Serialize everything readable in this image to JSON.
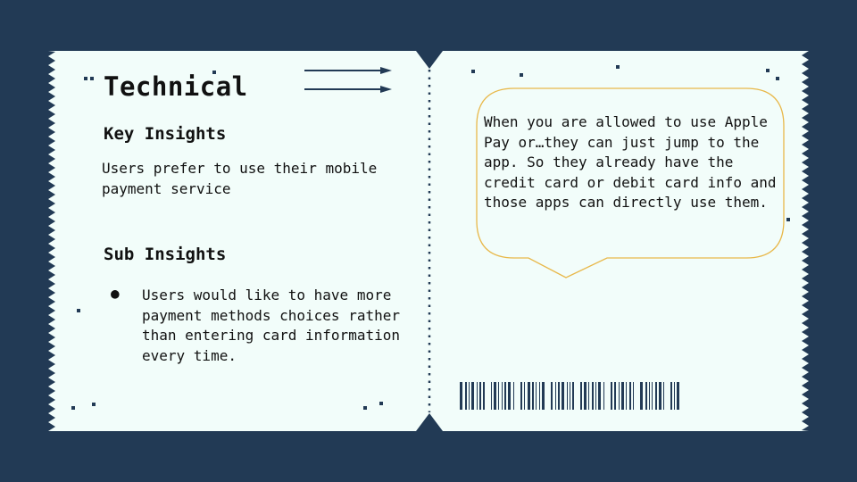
{
  "ticket": {
    "title": "Technical",
    "key_insights": {
      "heading": "Key Insights",
      "text": "Users prefer to use their mobile payment service"
    },
    "sub_insights": {
      "heading": "Sub Insights",
      "bullet": "●",
      "items": [
        "Users would like to have more payment methods choices rather than entering card information every time."
      ]
    },
    "quote": "When you are allowed to use Apple Pay or…they can just jump to the app. So they already have the credit card or debit card info and those apps can directly use them."
  },
  "colors": {
    "background": "#223a55",
    "ticket": "#f2fdfa",
    "accent_dark": "#223a55",
    "bubble_border": "#e8b84a"
  },
  "icons": [
    "arrow-right-icon",
    "speech-bubble",
    "barcode"
  ]
}
